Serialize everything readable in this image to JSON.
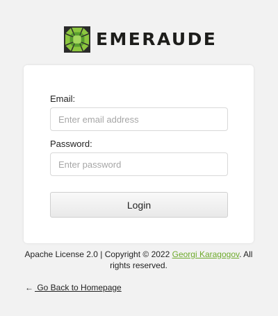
{
  "brand": {
    "name": "EMERAUDE",
    "logo_icon": "emerald-gem-icon",
    "logo_colors": [
      "#8cc63f",
      "#5a9e2f",
      "#3f7a22",
      "#2e2e2e"
    ]
  },
  "form": {
    "email_label": "Email:",
    "email_placeholder": "Enter email address",
    "email_value": "",
    "password_label": "Password:",
    "password_placeholder": "Enter password",
    "password_value": "",
    "login_label": "Login"
  },
  "footer": {
    "license_prefix": "Apache License 2.0 | Copyright © 2022 ",
    "author_link": "Georgi Karagogov",
    "license_suffix": ". All rights reserved.",
    "link_color": "#6eaa2c"
  },
  "back_link": {
    "arrow_icon": "left-arrow-icon",
    "arrow": "←",
    "label": " Go Back to Homepage"
  }
}
